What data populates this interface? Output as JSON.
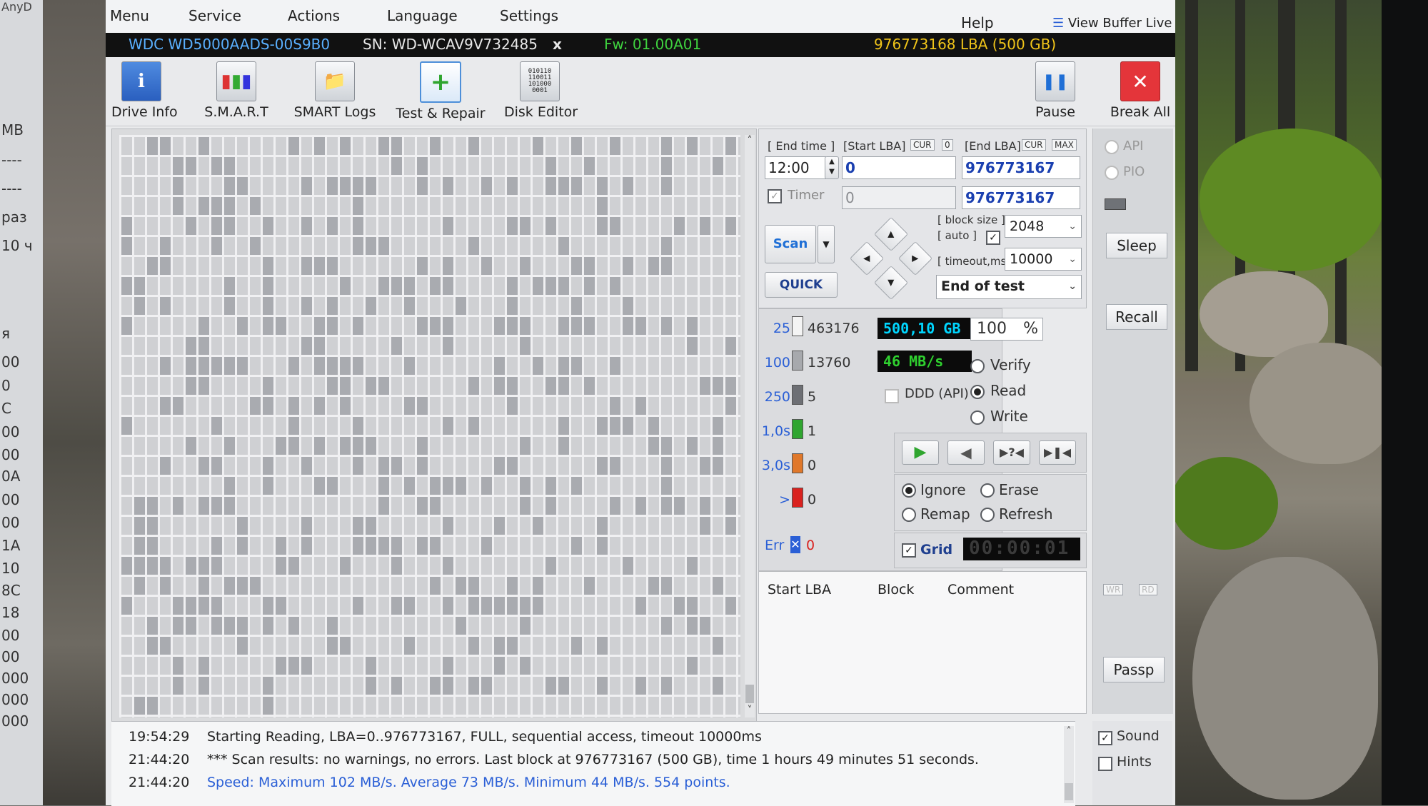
{
  "left_panel": {
    "title_fragment": "AnyD",
    "rows": [
      "MB",
      "----",
      "----",
      "раз",
      "10 ч",
      "я",
      "00",
      "0",
      "C",
      "00",
      "00",
      "0A",
      "00",
      "00",
      "1A",
      "10",
      "8C",
      "18",
      "00",
      "00",
      "000",
      "000",
      "000"
    ]
  },
  "menu": {
    "items": [
      "Menu",
      "Service",
      "Actions",
      "Language",
      "Settings"
    ],
    "help": "Help",
    "view_buffer": "View Buffer Live"
  },
  "drive": {
    "model": "WDC WD5000AADS-00S9B0",
    "serial": "SN: WD-WCAV9V732485",
    "close": "x",
    "firmware": "Fw: 01.00A01",
    "capacity": "976773168 LBA (500 GB)"
  },
  "toolbar": {
    "drive_info": "Drive Info",
    "smart": "S.M.A.R.T",
    "smart_logs": "SMART Logs",
    "test_repair": "Test & Repair",
    "disk_editor": "Disk Editor",
    "pause": "Pause",
    "break_all": "Break All"
  },
  "scan_settings": {
    "end_time_label": "[ End time ]",
    "end_time_value": "12:00",
    "timer_label": "Timer",
    "start_lba_label": "[Start LBA]",
    "cur_label": "CUR",
    "zero_label": "0",
    "start_lba_value": "0",
    "start_lba_current": "0",
    "end_lba_label": "[End LBA]",
    "max_label": "MAX",
    "end_lba_value": "976773167",
    "end_lba_current": "976773167",
    "scan_button": "Scan",
    "quick_button": "QUICK",
    "block_size_label": "[ block size ]",
    "auto_label": "[ auto ]",
    "block_size_value": "2048",
    "timeout_label": "[ timeout,ms ]",
    "timeout_value": "10000",
    "end_action": "End of test"
  },
  "stats": {
    "rows": [
      {
        "label": "25",
        "count": "463176",
        "color": "#f4f4f4"
      },
      {
        "label": "100",
        "count": "13760",
        "color": "#a7a9ad"
      },
      {
        "label": "250",
        "count": "5",
        "color": "#6d6f74"
      },
      {
        "label": "1,0s",
        "count": "1",
        "color": "#2fa52f"
      },
      {
        "label": "3,0s",
        "count": "0",
        "color": "#e0782a"
      },
      {
        "label": ">",
        "count": "0",
        "color": "#d9221f"
      }
    ],
    "err_label": "Err",
    "err_count": "0",
    "scanned": "500,10 GB",
    "percent": "100",
    "percent_sign": "%",
    "speed": "46 MB/s",
    "ddd_label": "DDD (API)",
    "verify": "Verify",
    "read": "Read",
    "write": "Write",
    "ignore": "Ignore",
    "erase": "Erase",
    "remap": "Remap",
    "refresh": "Refresh",
    "grid_label": "Grid",
    "elapsed": "00:00:01"
  },
  "right_col": {
    "api": "API",
    "pio": "PIO",
    "sleep": "Sleep",
    "recall": "Recall",
    "wr": "WR",
    "rd": "RD",
    "passp": "Passp",
    "sound": "Sound",
    "hints": "Hints"
  },
  "log_table": {
    "col_start": "Start LBA",
    "col_block": "Block",
    "col_comment": "Comment"
  },
  "log": [
    {
      "time": "19:54:29",
      "text": "Starting Reading, LBA=0..976773167, FULL, sequential access, timeout 10000ms",
      "color": "#222222"
    },
    {
      "time": "21:44:20",
      "text": "*** Scan results: no warnings, no errors. Last block at 976773167 (500 GB), time 1 hours 49 minutes 51 seconds.",
      "color": "#222222"
    },
    {
      "time": "21:44:20",
      "text": "Speed: Maximum 102 MB/s. Average 73 MB/s. Minimum 44 MB/s. 554 points.",
      "color": "#2a5fd6"
    }
  ]
}
